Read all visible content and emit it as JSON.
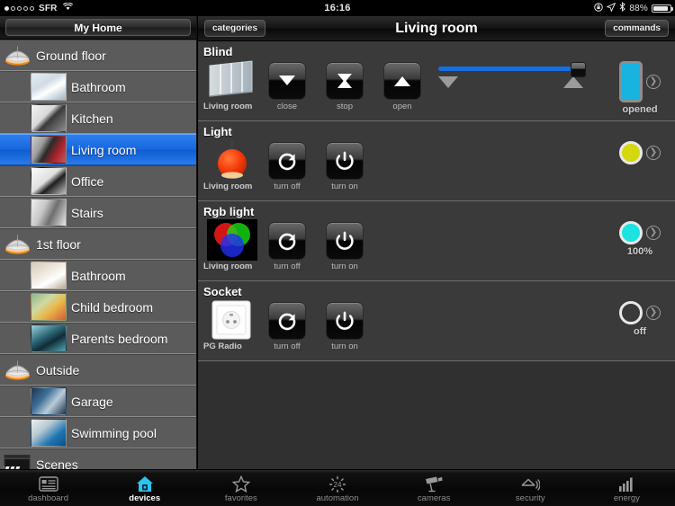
{
  "status_bar": {
    "signal_dots": 5,
    "signal_active": 1,
    "carrier": "SFR",
    "wifi_icon": "wifi-icon",
    "time": "16:16",
    "rotation_lock_icon": "rotation-lock-icon",
    "location_icon": "location-arrow-icon",
    "bluetooth_icon": "bluetooth-icon",
    "battery_percent": "88%",
    "battery_icon": "battery-icon"
  },
  "sidebar": {
    "home_button": "My Home",
    "groups": [
      {
        "name": "Ground floor",
        "icon": "floor-icon",
        "rooms": [
          {
            "name": "Bathroom",
            "thumb": "bathroom-thumb",
            "selected": false
          },
          {
            "name": "Kitchen",
            "thumb": "kitchen-thumb",
            "selected": false
          },
          {
            "name": "Living room",
            "thumb": "living-room-thumb",
            "selected": true
          },
          {
            "name": "Office",
            "thumb": "office-thumb",
            "selected": false
          },
          {
            "name": "Stairs",
            "thumb": "stairs-thumb",
            "selected": false
          }
        ]
      },
      {
        "name": "1st floor",
        "icon": "floor-icon",
        "rooms": [
          {
            "name": "Bathroom",
            "thumb": "bathroom2-thumb",
            "selected": false
          },
          {
            "name": "Child bedroom",
            "thumb": "child-bedroom-thumb",
            "selected": false
          },
          {
            "name": "Parents bedroom",
            "thumb": "parents-bedroom-thumb",
            "selected": false
          }
        ]
      },
      {
        "name": "Outside",
        "icon": "floor-icon",
        "rooms": [
          {
            "name": "Garage",
            "thumb": "garage-thumb",
            "selected": false
          },
          {
            "name": "Swimming pool",
            "thumb": "swimming-pool-thumb",
            "selected": false
          }
        ]
      }
    ],
    "scenes": {
      "name": "Scenes",
      "icon": "scenes-icon"
    }
  },
  "header": {
    "left_button": "categories",
    "title": "Living room",
    "right_button": "commands"
  },
  "sections": [
    {
      "title": "Blind",
      "device_name": "Living room",
      "device_icon": "blind-icon",
      "commands": [
        {
          "label": "close",
          "icon": "triangle-down-icon"
        },
        {
          "label": "stop",
          "icon": "hourglass-icon"
        },
        {
          "label": "open",
          "icon": "triangle-up-icon"
        }
      ],
      "slider": {
        "value": 100,
        "min": 0,
        "max": 100,
        "down_icon": "triangle-down-icon",
        "up_icon": "triangle-up-icon"
      },
      "state": {
        "type": "blind",
        "label": "opened",
        "color": "#18b4e0"
      },
      "detail_icon": "chevron-right-icon"
    },
    {
      "title": "Light",
      "device_name": "Living room",
      "device_icon": "pendant-lamp-icon",
      "commands": [
        {
          "label": "turn off",
          "icon": "power-off-icon"
        },
        {
          "label": "turn on",
          "icon": "power-on-icon"
        }
      ],
      "slider": null,
      "state": {
        "type": "circle",
        "label": "",
        "color": "#d5d80e"
      },
      "detail_icon": "chevron-right-icon"
    },
    {
      "title": "Rgb light",
      "device_name": "Living room",
      "device_icon": "rgb-light-icon",
      "commands": [
        {
          "label": "turn off",
          "icon": "power-off-icon"
        },
        {
          "label": "turn on",
          "icon": "power-on-icon"
        }
      ],
      "slider": null,
      "state": {
        "type": "circle",
        "label": "100%",
        "color": "#1ce2e2"
      },
      "detail_icon": "chevron-right-icon"
    },
    {
      "title": "Socket",
      "device_name": "PG Radio",
      "device_icon": "socket-icon",
      "commands": [
        {
          "label": "turn off",
          "icon": "power-off-icon"
        },
        {
          "label": "turn on",
          "icon": "power-on-icon"
        }
      ],
      "slider": null,
      "state": {
        "type": "circle",
        "label": "off",
        "color": "transparent"
      },
      "detail_icon": "chevron-right-icon"
    }
  ],
  "tabbar": [
    {
      "label": "dashboard",
      "icon": "dashboard-icon",
      "active": false
    },
    {
      "label": "devices",
      "icon": "devices-home-icon",
      "active": true
    },
    {
      "label": "favorites",
      "icon": "star-icon",
      "active": false
    },
    {
      "label": "automation",
      "icon": "clock-24-icon",
      "active": false
    },
    {
      "label": "cameras",
      "icon": "camera-icon",
      "active": false
    },
    {
      "label": "security",
      "icon": "security-home-icon",
      "active": false
    },
    {
      "label": "energy",
      "icon": "bars-icon",
      "active": false
    }
  ],
  "colors": {
    "accent_blue": "#1470e0",
    "selection_blue": "#1667dd",
    "sidebar_bg": "#5b5b5b",
    "section_bg": "#3a3a3a",
    "panel_bg": "#303030"
  }
}
